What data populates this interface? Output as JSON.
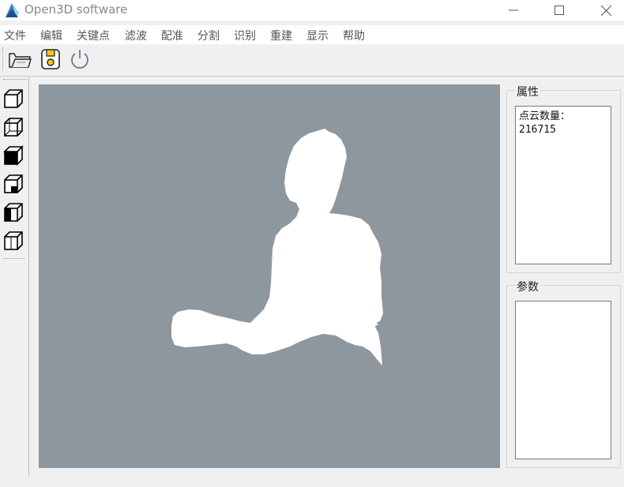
{
  "window": {
    "title": "Open3D software",
    "icon": "app-logo-icon",
    "controls": [
      "minimize-icon",
      "maximize-icon",
      "close-icon"
    ]
  },
  "menu": {
    "items": [
      "文件",
      "编辑",
      "关键点",
      "滤波",
      "配准",
      "分割",
      "识别",
      "重建",
      "显示",
      "帮助"
    ]
  },
  "toolbar": {
    "buttons": [
      "open-folder-icon",
      "save-disk-icon",
      "power-icon"
    ]
  },
  "view_toolbar": {
    "buttons": [
      "view-cube-front-icon",
      "view-cube-back-icon",
      "view-cube-top-icon",
      "view-cube-bottom-icon",
      "view-cube-left-icon",
      "view-cube-right-icon"
    ]
  },
  "viewport": {
    "background": "#8e979e",
    "point_cloud_color": "#ffffff"
  },
  "properties": {
    "title": "属性",
    "label": "点云数量：",
    "value": "216715"
  },
  "parameters": {
    "title": "参数"
  }
}
